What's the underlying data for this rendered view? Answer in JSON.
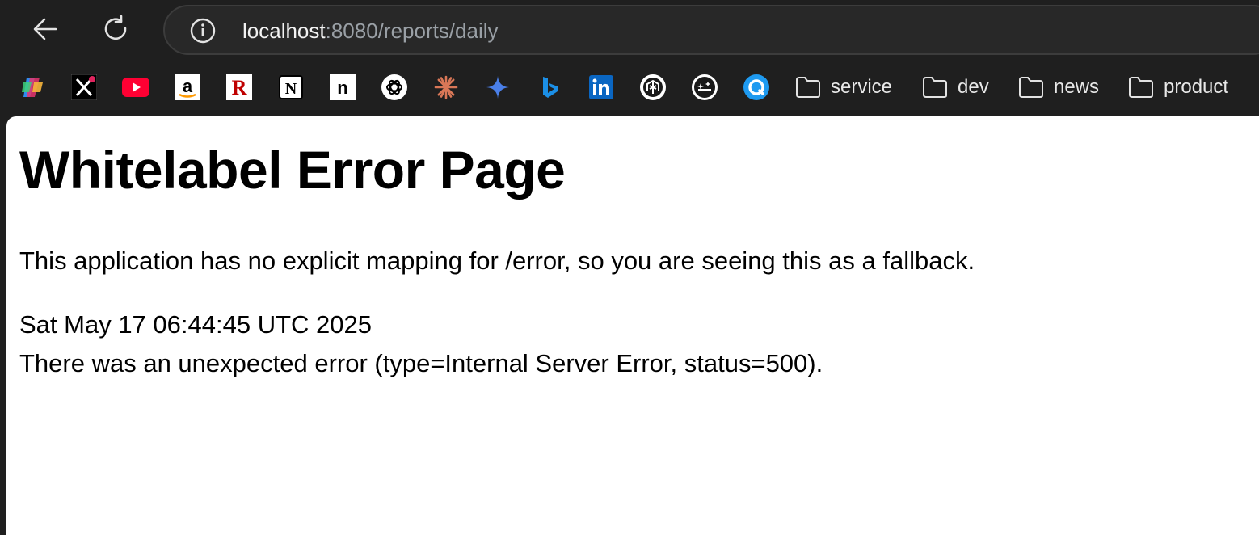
{
  "browser": {
    "address_bar": {
      "host": "localhost",
      "rest": ":8080/reports/daily"
    },
    "bookmarks": [
      {
        "name": "copilot-icon"
      },
      {
        "name": "x-icon"
      },
      {
        "name": "youtube-icon"
      },
      {
        "name": "amazon-icon"
      },
      {
        "name": "rakuten-icon"
      },
      {
        "name": "notion-icon"
      },
      {
        "name": "note-icon"
      },
      {
        "name": "chatgpt-icon"
      },
      {
        "name": "claude-icon"
      },
      {
        "name": "gemini-icon"
      },
      {
        "name": "bing-icon"
      },
      {
        "name": "linkedin-icon"
      },
      {
        "name": "perplexity-icon"
      },
      {
        "name": "felo-icon"
      },
      {
        "name": "qiita-icon"
      }
    ],
    "folders": [
      {
        "label": "service"
      },
      {
        "label": "dev"
      },
      {
        "label": "news"
      },
      {
        "label": "product"
      }
    ]
  },
  "page": {
    "title": "Whitelabel Error Page",
    "message": "This application has no explicit mapping for /error, so you are seeing this as a fallback.",
    "timestamp": "Sat May 17 06:44:45 UTC 2025",
    "error": "There was an unexpected error (type=Internal Server Error, status=500)."
  }
}
